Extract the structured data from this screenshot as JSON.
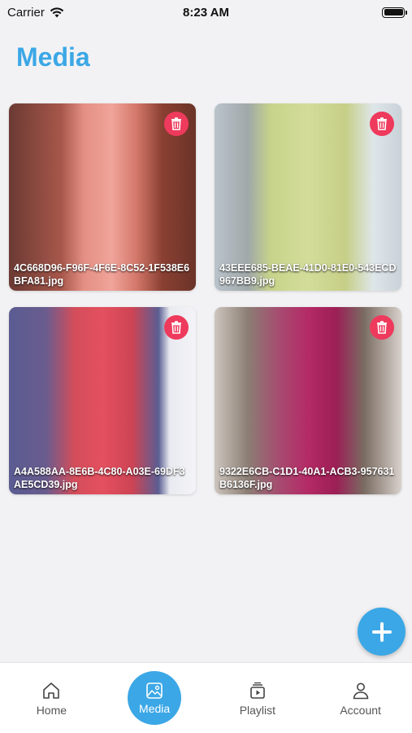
{
  "status_bar": {
    "carrier": "Carrier",
    "time": "8:23 AM"
  },
  "header": {
    "title": "Media"
  },
  "media_items": [
    {
      "filename": "4C668D96-F96F-4F6E-8C52-1F538E6BFA81.jpg",
      "bg": "linear-gradient(90deg,#6b3a33 0%,#a7574a 28%,#e48f83 40%,#f0a49a 55%,#d4786b 68%,#8a4032 82%,#6b3328 100%)"
    },
    {
      "filename": "43EEE685-BEAE-41D0-81E0-543ECD967BB9.jpg",
      "bg": "linear-gradient(90deg,#b9c3cb 0%,#a0a8a9 18%,#c7d38a 30%,#d3dd9a 50%,#c6cf86 70%,#dfe6ea 85%,#c9d2d8 100%)"
    },
    {
      "filename": "A4A588AA-8E6B-4C80-A03E-69DF3AE5CD39.jpg",
      "bg": "linear-gradient(90deg,#5a5c92 0%,#6a5c8e 20%,#d44d5a 35%,#e4505f 50%,#cd4454 66%,#5b5e93 80%,#e9eaf0 86%,#f4f4f8 100%)"
    },
    {
      "filename": "9322E6CB-C1D1-40A1-ACB3-957631B6136F.jpg",
      "bg": "linear-gradient(90deg,#cdc5be 0%,#8b7e74 18%,#a74a70 35%,#b42a66 50%,#9c1f55 65%,#7a6c62 80%,#d8d1cb 100%)"
    }
  ],
  "fab": {
    "icon": "plus-icon"
  },
  "tabs": [
    {
      "label": "Home",
      "icon": "home-icon"
    },
    {
      "label": "Media",
      "icon": "media-icon",
      "active": true
    },
    {
      "label": "Playlist",
      "icon": "playlist-icon"
    },
    {
      "label": "Account",
      "icon": "account-icon"
    }
  ],
  "colors": {
    "accent": "#3ba7e6",
    "delete": "#ee3a5c",
    "background": "#f2f2f4"
  }
}
